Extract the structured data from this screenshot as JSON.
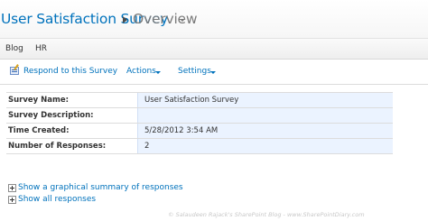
{
  "header": {
    "site_title": "User Satisfaction Survey",
    "page_name": "Overview"
  },
  "topnav": {
    "items": [
      "Blog",
      "HR"
    ]
  },
  "toolbar": {
    "respond_label": "Respond to this Survey",
    "actions_label": "Actions",
    "settings_label": "Settings"
  },
  "details": {
    "rows": [
      {
        "label": "Survey Name:",
        "value": "User Satisfaction Survey"
      },
      {
        "label": "Survey Description:",
        "value": ""
      },
      {
        "label": "Time Created:",
        "value": "5/28/2012 3:54 AM"
      },
      {
        "label": "Number of Responses:",
        "value": "2"
      }
    ]
  },
  "links": {
    "graphical_summary": "Show a graphical summary of responses",
    "all_responses": "Show all responses"
  },
  "watermark": "© Salaudeen Rajack's SharePoint Blog - www.SharePointDiary.com",
  "colors": {
    "link": "#0072bc",
    "value_background": "#ebf3ff"
  }
}
